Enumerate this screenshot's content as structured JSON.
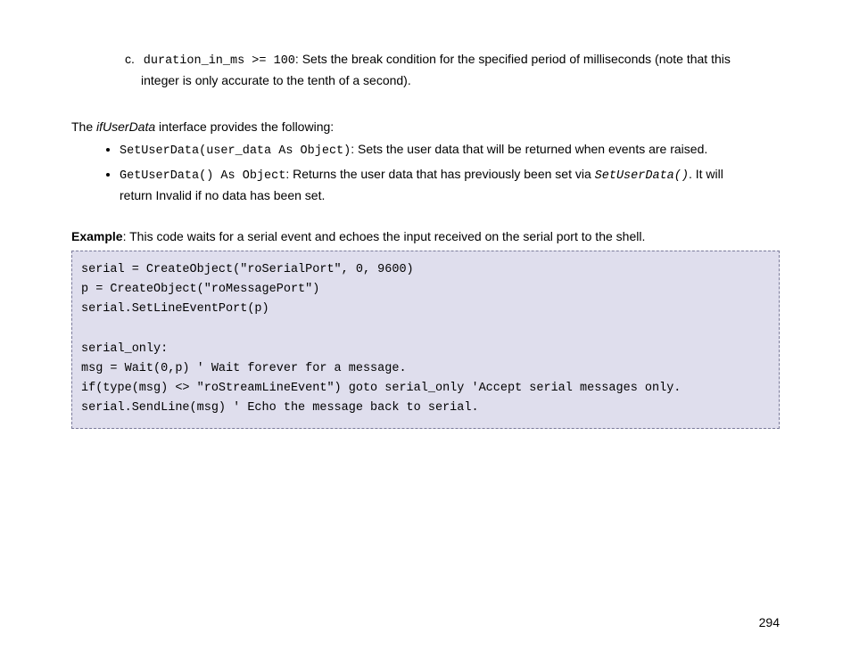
{
  "item_c": {
    "label": "c.",
    "code": "duration_in_ms >= 100",
    "text1": ": Sets the break condition for the specified period of milliseconds (note that this",
    "text2": "integer is only accurate to the tenth of a second)."
  },
  "intro": {
    "pre": "The ",
    "italic": "ifUserData",
    "post": " interface provides the following:"
  },
  "bullets": [
    {
      "code": "SetUserData(user_data As Object)",
      "text": ": Sets the user data that will be returned when events are raised."
    },
    {
      "code": "GetUserData() As Object",
      "text_a": ": Returns the user data that has previously been set via ",
      "ref": "SetUserData()",
      "text_b": ". It will",
      "text_c": "return Invalid if no data has been set."
    }
  ],
  "example": {
    "label": "Example",
    "text": ": This code waits for a serial event and echoes the input received on the serial port to the shell."
  },
  "code": "serial = CreateObject(\"roSerialPort\", 0, 9600)\np = CreateObject(\"roMessagePort\")\nserial.SetLineEventPort(p)\n\nserial_only:\nmsg = Wait(0,p) ' Wait forever for a message.\nif(type(msg) <> \"roStreamLineEvent\") goto serial_only 'Accept serial messages only.\nserial.SendLine(msg) ' Echo the message back to serial.",
  "page_number": "294"
}
